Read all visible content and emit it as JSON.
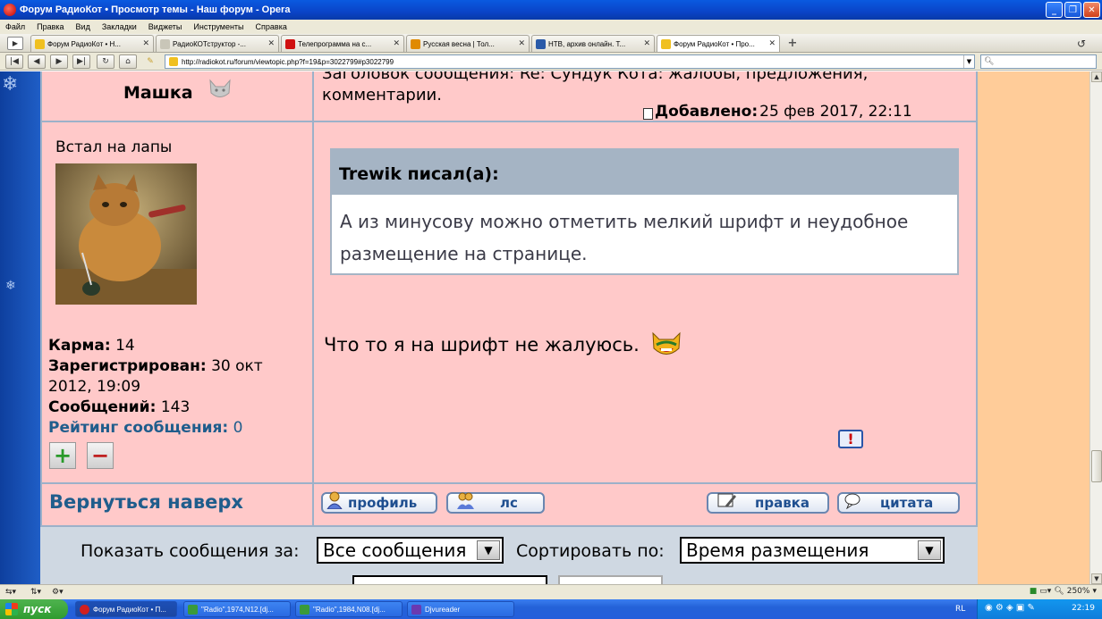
{
  "window": {
    "title": "Форум РадиоКот • Просмотр темы - Наш форум - Opera",
    "buttons": [
      "_",
      "❐",
      "✕"
    ]
  },
  "menu": [
    "Файл",
    "Правка",
    "Вид",
    "Закладки",
    "Виджеты",
    "Инструменты",
    "Справка"
  ],
  "tabs": [
    {
      "label": "Форум РадиоКот • Н...",
      "icon_color": "#f0c020"
    },
    {
      "label": "РадиоКОТструктор -...",
      "icon_color": "#c9c6b8"
    },
    {
      "label": "Телепрограмма на с...",
      "icon_color": "#d01010"
    },
    {
      "label": "Русская весна | Тол...",
      "icon_color": "#e08a00"
    },
    {
      "label": "НТВ, архив онлайн. Т...",
      "icon_color": "#2a5aa8"
    },
    {
      "label": "Форум РадиоКот • Про...",
      "icon_color": "#f0c020",
      "active": true
    }
  ],
  "address": {
    "url": "http://radiokot.ru/forum/viewtopic.php?f=19&p=3022799#p3022799",
    "search_icon": "search-icon"
  },
  "post": {
    "author": "Машка",
    "subject": "Заголовок сообщения: Re: Сундук Кота: жалобы, предложения, комментарии.",
    "posted_label": "Добавлено:",
    "posted_date": "25 фев 2017, 22:11",
    "rank": "Встал на лапы",
    "karma_label": "Карма:",
    "karma": "14",
    "registered_label": "Зарегистрирован:",
    "registered": "30 окт 2012, 19:09",
    "messages_label": "Сообщений:",
    "messages": "143",
    "rating_label": "Рейтинг сообщения:",
    "rating": "0",
    "vote_plus": "+",
    "vote_minus": "−",
    "quote_author": "Trewik писал(а):",
    "quote_text": "А из минусову можно отметить мелкий шрифт и неудобное размещение на странице.",
    "text": "Что то я на шрифт не жалуюсь.",
    "report": "!"
  },
  "footer": {
    "back_to_top": "Вернуться наверх",
    "profile_btn": "профиль",
    "pm_btn": "лс",
    "edit_btn": "правка",
    "quote_btn": "цитата"
  },
  "sort": {
    "show_label": "Показать сообщения за:",
    "show_value": "Все сообщения",
    "sort_label": "Сортировать по:",
    "sort_value": "Время размещения"
  },
  "statusbar": {
    "zoom": "250%",
    "zoom_icon": "magnifier-icon"
  },
  "taskbar": {
    "start": "пуск",
    "items": [
      {
        "label": "Форум РадиоКот • П...",
        "icon_color": "#d02020",
        "active": true
      },
      {
        "label": "\"Radio\",1974,N12.[dj...",
        "icon_color": "#3a9a3a"
      },
      {
        "label": "\"Radio\",1984,N08.[dj...",
        "icon_color": "#3a9a3a"
      },
      {
        "label": "Djvureader",
        "icon_color": "#6a3ab0"
      }
    ],
    "lang": "RL",
    "clock": "22:19"
  }
}
